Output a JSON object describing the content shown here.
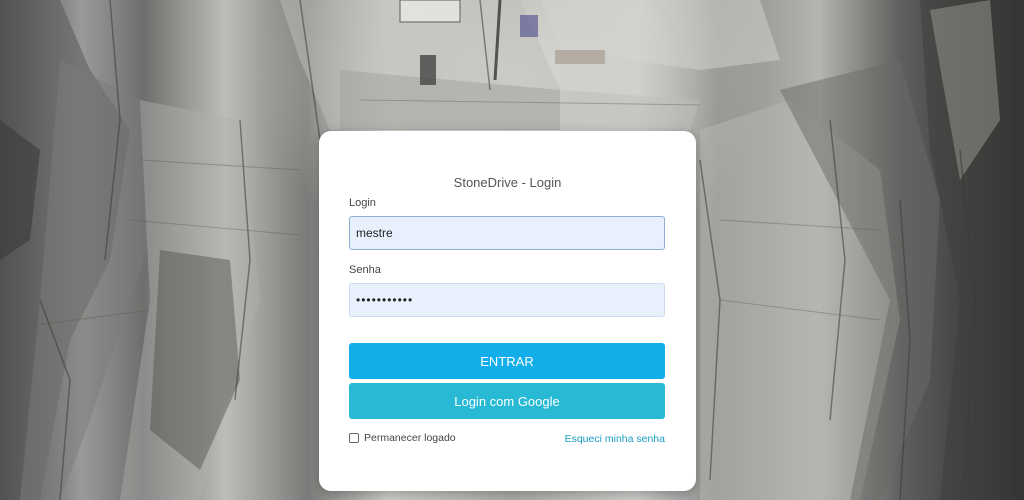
{
  "background": {
    "scene": "stone-quarry-photo"
  },
  "login_card": {
    "title": "StoneDrive - Login",
    "login_label": "Login",
    "login_value": "mestre",
    "senha_label": "Senha",
    "senha_value": "•••••••••••",
    "entrar_label": "ENTRAR",
    "google_label": "Login com Google",
    "remember_label": "Permanecer logado",
    "remember_checked": false,
    "forgot_label": "Esqueci minha senha"
  },
  "colors": {
    "entrar_button": "#12aee9",
    "google_button": "#28b9d4",
    "input_background": "#e8f0fe",
    "link": "#1a9dc7"
  }
}
